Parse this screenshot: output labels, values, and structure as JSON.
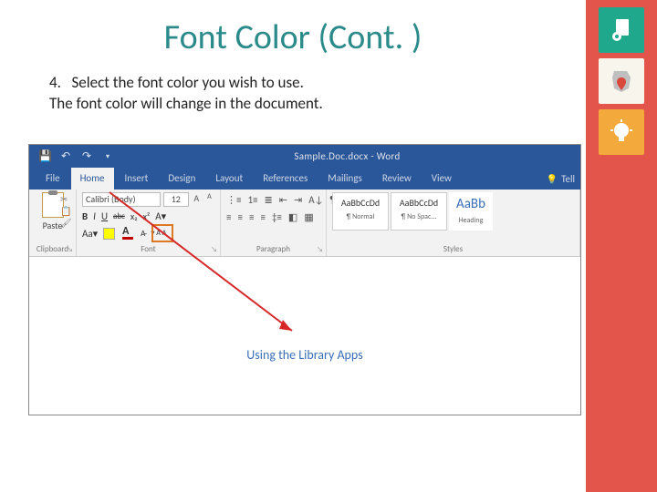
{
  "title": "Font Color (Cont. )",
  "step_num": "4.",
  "step_text": "Select the font color you wish to use.",
  "note": "The font color will change in the document.",
  "word": {
    "doc_title": "Sample.Doc.docx - Word",
    "tabs": [
      "File",
      "Home",
      "Insert",
      "Design",
      "Layout",
      "References",
      "Mailings",
      "Review",
      "View"
    ],
    "tell": "Tell",
    "paste": "Paste",
    "clipboard_label": "Clipboard",
    "font_name": "Calibri (Body)",
    "font_size": "12",
    "font_label": "Font",
    "para_label": "Paragraph",
    "styles_label": "Styles",
    "style_preview": "AaBbCcDd",
    "style_preview_accent": "AaBb",
    "style_names": [
      "¶ Normal",
      "¶ No Spac...",
      "Heading"
    ],
    "doc_body": "Using the Library Apps"
  }
}
